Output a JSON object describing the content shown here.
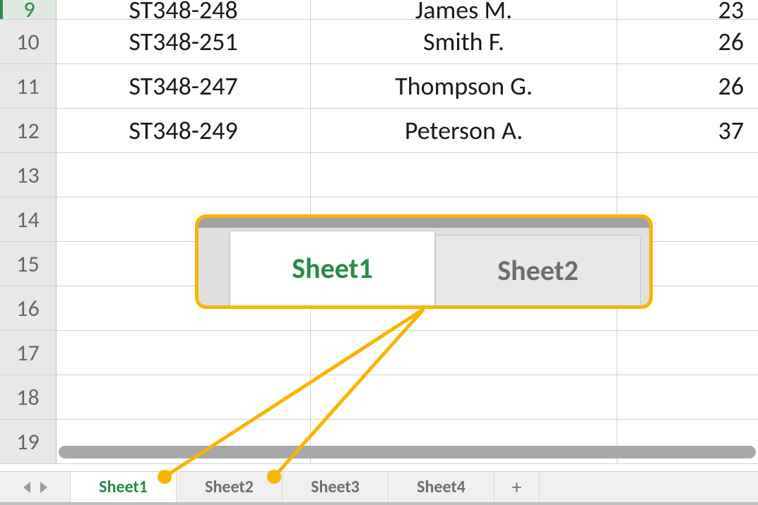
{
  "rows": [
    {
      "num": "9",
      "a": "ST348-248",
      "b": "James M.",
      "c": "23"
    },
    {
      "num": "10",
      "a": "ST348-251",
      "b": "Smith F.",
      "c": "26"
    },
    {
      "num": "11",
      "a": "ST348-247",
      "b": "Thompson G.",
      "c": "26"
    },
    {
      "num": "12",
      "a": "ST348-249",
      "b": "Peterson A.",
      "c": "37"
    },
    {
      "num": "13",
      "a": "",
      "b": "",
      "c": ""
    },
    {
      "num": "14",
      "a": "",
      "b": "",
      "c": ""
    },
    {
      "num": "15",
      "a": "",
      "b": "",
      "c": ""
    },
    {
      "num": "16",
      "a": "",
      "b": "",
      "c": ""
    },
    {
      "num": "17",
      "a": "",
      "b": "",
      "c": ""
    },
    {
      "num": "18",
      "a": "",
      "b": "",
      "c": ""
    },
    {
      "num": "19",
      "a": "",
      "b": "",
      "c": ""
    }
  ],
  "tabs": {
    "items": [
      {
        "label": "Sheet1",
        "active": true
      },
      {
        "label": "Sheet2",
        "active": false
      },
      {
        "label": "Sheet3",
        "active": false
      },
      {
        "label": "Sheet4",
        "active": false
      }
    ],
    "add": "+"
  },
  "callout": {
    "tab1": "Sheet1",
    "tab2": "Sheet2"
  },
  "colors": {
    "highlight": "#f7b500",
    "active_tab_text": "#2a8a4a"
  }
}
